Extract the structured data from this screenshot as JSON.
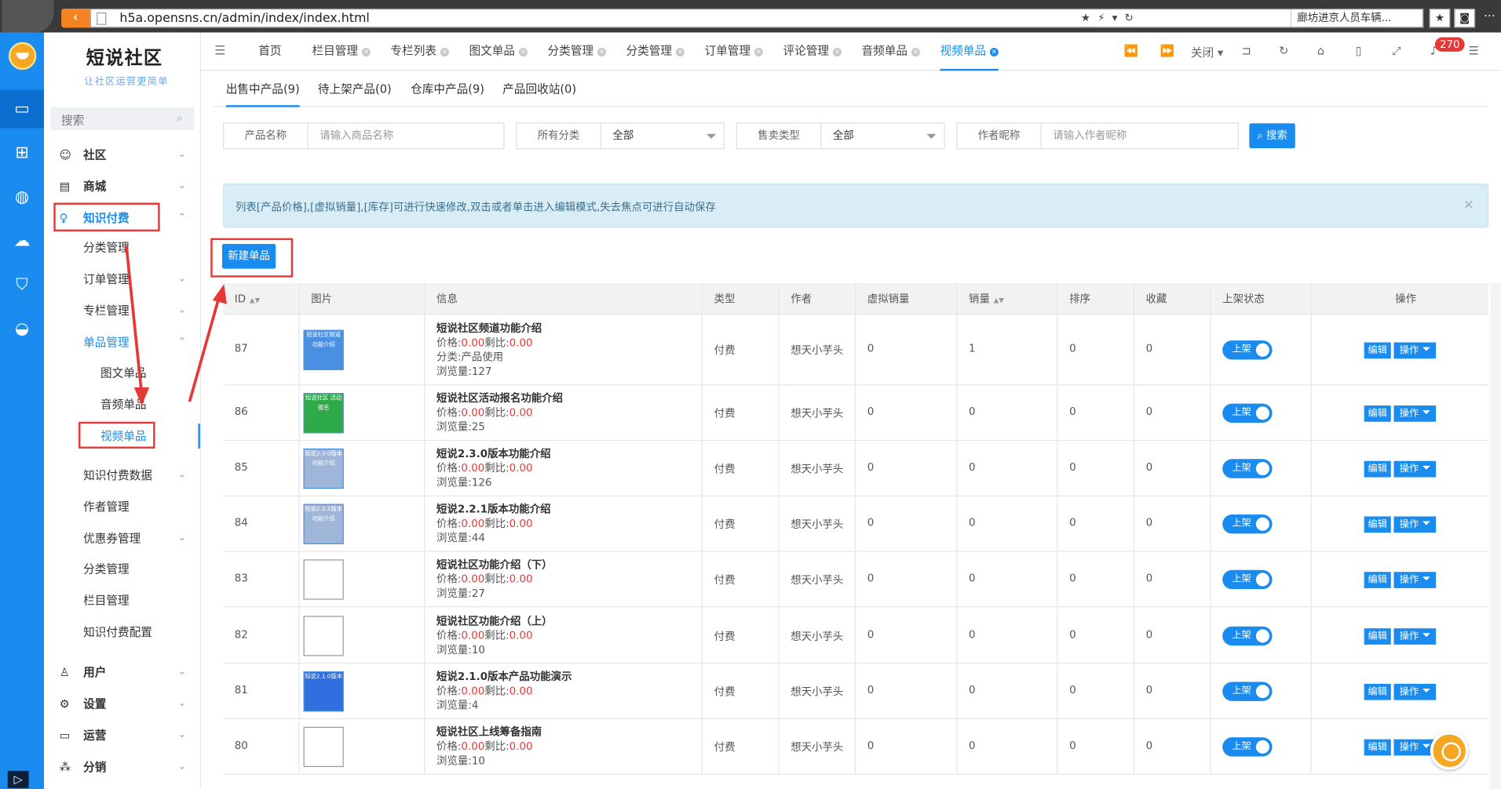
{
  "browser": {
    "url": "h5a.opensns.cn/admin/index/index.html",
    "search_hint": "廊坊进京人员车辆...",
    "url_icons": "★ ⚡ ▾ ↻"
  },
  "sidebar": {
    "brand_title": "短说社区",
    "brand_sub": "让社区运营更简单",
    "search_placeholder": "搜索",
    "items": [
      {
        "label": "社区",
        "icon": "☺",
        "chevron": "⌄"
      },
      {
        "label": "商城",
        "icon": "▤",
        "chevron": "⌄"
      },
      {
        "label": "知识付费",
        "icon": "♀",
        "chevron": "⌃"
      },
      {
        "label": "分类管理"
      },
      {
        "label": "订单管理",
        "chevron": "⌄"
      },
      {
        "label": "专栏管理",
        "chevron": "⌄"
      },
      {
        "label": "单品管理",
        "chevron": "⌃"
      },
      {
        "label": "图文单品"
      },
      {
        "label": "音频单品"
      },
      {
        "label": "视频单品"
      },
      {
        "label": "知识付费数据",
        "chevron": "⌄"
      },
      {
        "label": "作者管理"
      },
      {
        "label": "优惠券管理",
        "chevron": "⌄"
      },
      {
        "label": "分类管理"
      },
      {
        "label": "栏目管理"
      },
      {
        "label": "知识付费配置"
      },
      {
        "label": "用户",
        "icon": "♙",
        "chevron": "⌄"
      },
      {
        "label": "设置",
        "icon": "⚙",
        "chevron": "⌄"
      },
      {
        "label": "运营",
        "icon": "▭",
        "chevron": "⌄"
      },
      {
        "label": "分销",
        "icon": "⁂",
        "chevron": "⌄"
      }
    ]
  },
  "rail": {
    "icons": [
      "monitor-icon",
      "grid-icon",
      "globe-icon",
      "cloud-icon",
      "shield-icon",
      "robot-icon"
    ],
    "glyphs": [
      "▭",
      "⊞",
      "◍",
      "☁",
      "⛉",
      "◒"
    ]
  },
  "page_tabs": [
    {
      "label": "首页",
      "closable": false
    },
    {
      "label": "栏目管理",
      "closable": true
    },
    {
      "label": "专栏列表",
      "closable": true
    },
    {
      "label": "图文单品",
      "closable": true
    },
    {
      "label": "分类管理",
      "closable": true
    },
    {
      "label": "分类管理",
      "closable": true
    },
    {
      "label": "订单管理",
      "closable": true
    },
    {
      "label": "评论管理",
      "closable": true
    },
    {
      "label": "音频单品",
      "closable": true
    },
    {
      "label": "视频单品",
      "closable": true,
      "active": true
    }
  ],
  "tab_controls": {
    "close_label": "关闭",
    "notification_count": "270"
  },
  "sub_tabs": [
    {
      "label": "出售中产品(9)",
      "active": true
    },
    {
      "label": "待上架产品(0)"
    },
    {
      "label": "仓库中产品(9)"
    },
    {
      "label": "产品回收站(0)"
    }
  ],
  "filters": {
    "product_name_label": "产品名称",
    "product_name_placeholder": "请输入商品名称",
    "category_label": "所有分类",
    "category_value": "全部",
    "sale_type_label": "售卖类型",
    "sale_type_value": "全部",
    "author_label": "作者昵称",
    "author_placeholder": "请输入作者昵称",
    "search_button": "搜索"
  },
  "notice": {
    "text": "列表[产品价格],[虚拟销量],[库存]可进行快速修改,双击或者单击进入编辑模式,失去焦点可进行自动保存",
    "close": "×"
  },
  "new_button": "新建单品",
  "table": {
    "columns": [
      "ID",
      "图片",
      "信息",
      "类型",
      "作者",
      "虚拟销量",
      "销量",
      "排序",
      "收藏",
      "上架状态",
      "操作"
    ],
    "price_prefix": "价格:",
    "ratio_prefix": "剩比:",
    "category_prefix": "分类:",
    "views_prefix": "浏览量:",
    "switch_label": "上架",
    "edit_label": "编辑",
    "op_label": "操作",
    "rows": [
      {
        "id": "87",
        "thumb": "短说社区频道功能介绍",
        "thumb_color": "#4a90e2",
        "title": "短说社区频道功能介绍",
        "price": "0.00",
        "ratio": "0.00",
        "category": "产品使用",
        "views": "127",
        "type": "付费",
        "author": "想天小芋头",
        "virtual_sales": "0",
        "sales": "1",
        "sort": "0",
        "favorites": "0"
      },
      {
        "id": "86",
        "thumb": "短说社区 活动报名",
        "thumb_color": "#2eaa4a",
        "title": "短说社区活动报名功能介绍",
        "price": "0.00",
        "ratio": "0.00",
        "views": "25",
        "type": "付费",
        "author": "想天小芋头",
        "virtual_sales": "0",
        "sales": "0",
        "sort": "0",
        "favorites": "0"
      },
      {
        "id": "85",
        "thumb": "短说2.3.0版本功能介绍",
        "thumb_color": "#9fb6d8",
        "title": "短说2.3.0版本功能介绍",
        "price": "0.00",
        "ratio": "0.00",
        "views": "126",
        "type": "付费",
        "author": "想天小芋头",
        "virtual_sales": "0",
        "sales": "0",
        "sort": "0",
        "favorites": "0"
      },
      {
        "id": "84",
        "thumb": "短说2.2.1版本功能介绍",
        "thumb_color": "#9fb6d8",
        "title": "短说2.2.1版本功能介绍",
        "price": "0.00",
        "ratio": "0.00",
        "views": "44",
        "type": "付费",
        "author": "想天小芋头",
        "virtual_sales": "0",
        "sales": "0",
        "sort": "0",
        "favorites": "0"
      },
      {
        "id": "83",
        "thumb": "",
        "thumb_color": "#ffffff",
        "title": "短说社区功能介绍（下）",
        "price": "0.00",
        "ratio": "0.00",
        "views": "27",
        "type": "付费",
        "author": "想天小芋头",
        "virtual_sales": "0",
        "sales": "0",
        "sort": "0",
        "favorites": "0"
      },
      {
        "id": "82",
        "thumb": "",
        "thumb_color": "#ffffff",
        "title": "短说社区功能介绍（上）",
        "price": "0.00",
        "ratio": "0.00",
        "views": "10",
        "type": "付费",
        "author": "想天小芋头",
        "virtual_sales": "0",
        "sales": "0",
        "sort": "0",
        "favorites": "0"
      },
      {
        "id": "81",
        "thumb": "短说2.1.0版本",
        "thumb_color": "#2f6fe0",
        "title": "短说2.1.0版本产品功能演示",
        "price": "0.00",
        "ratio": "0.00",
        "views": "4",
        "type": "付费",
        "author": "想天小芋头",
        "virtual_sales": "0",
        "sales": "0",
        "sort": "0",
        "favorites": "0"
      },
      {
        "id": "80",
        "thumb": "",
        "thumb_color": "#ffffff",
        "title": "短说社区上线筹备指南",
        "price": "0.00",
        "ratio": "0.00",
        "views": "10",
        "type": "付费",
        "author": "想天小芋头",
        "virtual_sales": "0",
        "sales": "0",
        "sort": "0",
        "favorites": "0"
      }
    ]
  },
  "colors": {
    "accent": "#1a8cf0",
    "highlight_red": "#e53935",
    "notice_bg": "#d9edf7"
  }
}
